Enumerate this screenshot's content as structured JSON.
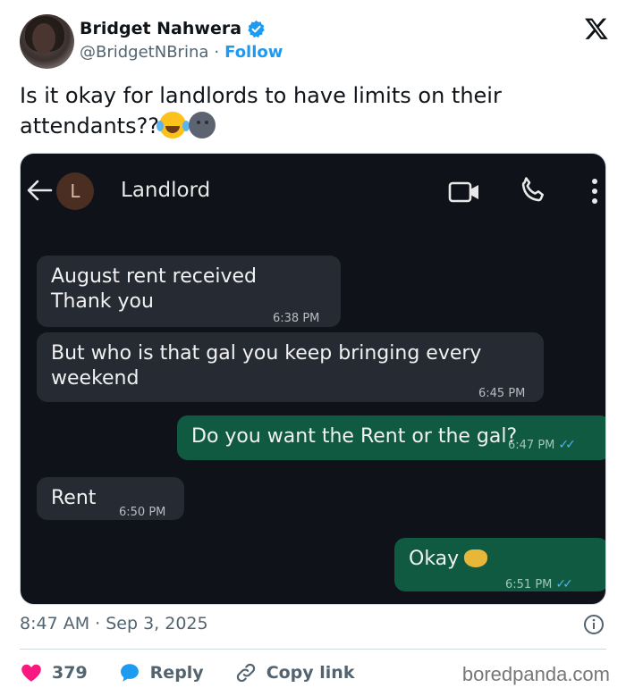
{
  "author": {
    "name": "Bridget Nahwera",
    "handle": "@BridgetNBrina",
    "separator": "·",
    "follow_label": "Follow"
  },
  "tweet": {
    "text": "Is it okay for landlords to have limits on their attendants??",
    "emojis": [
      "face-with-tears-of-joy",
      "new-moon-face"
    ]
  },
  "chat": {
    "contact_initial": "L",
    "contact_name": "Landlord",
    "messages": [
      {
        "direction": "in",
        "lines": [
          "August rent received",
          "Thank you"
        ],
        "time": "6:38 PM"
      },
      {
        "direction": "in",
        "lines": [
          "But who is that gal you keep bringing every",
          "weekend"
        ],
        "time": "6:45 PM"
      },
      {
        "direction": "out",
        "lines": [
          "Do you want the Rent or the gal?"
        ],
        "time": "6:47 PM",
        "read": true
      },
      {
        "direction": "in",
        "lines": [
          "Rent"
        ],
        "time": "6:50 PM"
      },
      {
        "direction": "out",
        "lines": [
          "Okay"
        ],
        "time": "6:51 PM",
        "read": true,
        "emoji": "handshake"
      }
    ]
  },
  "meta": {
    "timestamp": "8:47 AM · Sep 3, 2025"
  },
  "actions": {
    "like_count": "379",
    "reply_label": "Reply",
    "copy_link_label": "Copy link"
  },
  "watermark": "boredpanda.com",
  "colors": {
    "accent": "#1d9bf0",
    "like": "#f91880",
    "chat_bg": "#0f1218",
    "incoming_bubble": "#262b33",
    "outgoing_bubble": "#0f5a40"
  }
}
